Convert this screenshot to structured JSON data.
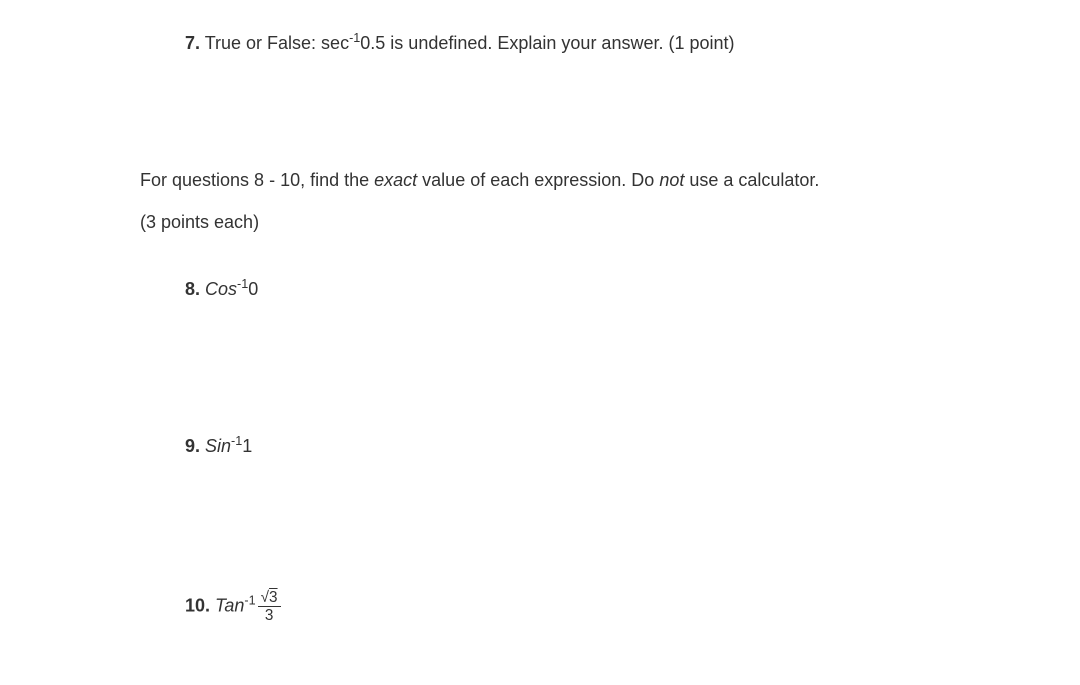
{
  "questions": {
    "q7": {
      "number": "7.",
      "text_before": " True or False: sec",
      "superscript": "-1",
      "text_after": "0.5 is undefined. Explain your answer. (1 point)"
    },
    "instructions": {
      "text_before": "For questions 8 - 10, find the ",
      "italic1": "exact",
      "text_mid": " value of each expression. Do ",
      "italic2": "not",
      "text_after": " use a calculator."
    },
    "points_note": "(3 points each)",
    "q8": {
      "number": "8.",
      "func": "Cos",
      "superscript": "-1",
      "arg": "0"
    },
    "q9": {
      "number": "9.",
      "func": "Sin",
      "superscript": "-1",
      "arg": "1"
    },
    "q10": {
      "number": "10.",
      "func": "Tan",
      "superscript": "-1",
      "sqrt_radicand": "3",
      "denom": "3"
    }
  }
}
